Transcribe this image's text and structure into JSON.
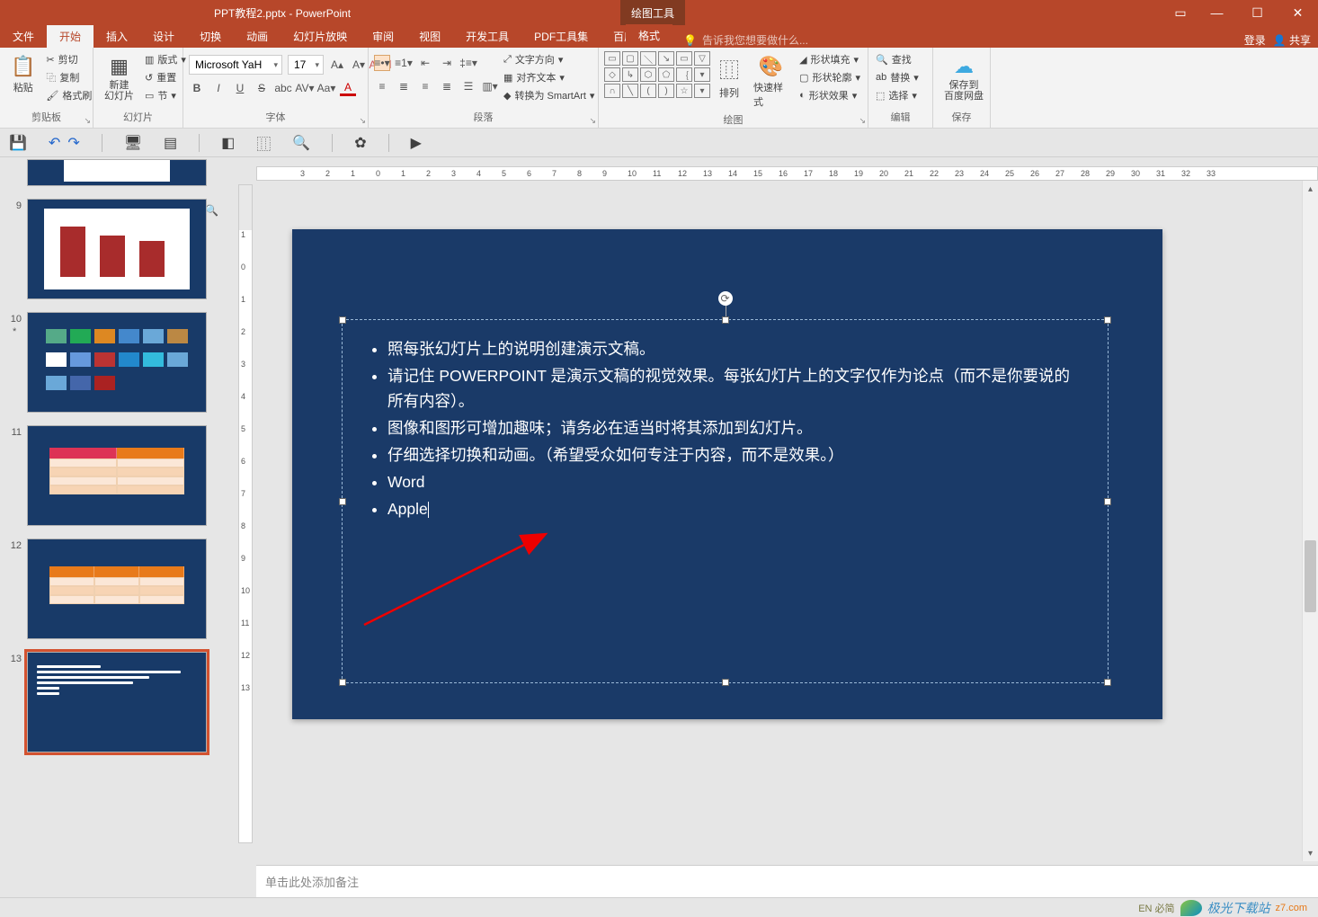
{
  "title": {
    "filename": "PPT教程2.pptx - PowerPoint",
    "drawing_tools": "绘图工具",
    "format_tab": "格式"
  },
  "window": {
    "login": "登录",
    "share": "共享"
  },
  "tell_me": "告诉我您想要做什么...",
  "menu": {
    "file": "文件",
    "home": "开始",
    "insert": "插入",
    "design": "设计",
    "transitions": "切换",
    "animations": "动画",
    "slideshow": "幻灯片放映",
    "review": "审阅",
    "view": "视图",
    "dev": "开发工具",
    "pdf": "PDF工具集",
    "baidu": "百度网盘"
  },
  "ribbon": {
    "clipboard": {
      "label": "剪贴板",
      "paste": "粘贴",
      "cut": "剪切",
      "copy": "复制",
      "painter": "格式刷"
    },
    "slides": {
      "label": "幻灯片",
      "new_slide": "新建\n幻灯片",
      "layout": "版式",
      "reset": "重置",
      "section": "节"
    },
    "font": {
      "label": "字体",
      "font_name": "Microsoft YaH",
      "font_size": "17",
      "bold": "B",
      "italic": "I",
      "underline": "U",
      "strike": "S",
      "shadow": "abc",
      "spacing": "AV",
      "case": "Aa"
    },
    "paragraph": {
      "label": "段落",
      "text_direction": "文字方向",
      "align_text": "对齐文本",
      "convert_smartart": "转换为 SmartArt"
    },
    "drawing": {
      "label": "绘图",
      "arrange": "排列",
      "quick_styles": "快速样式",
      "shape_fill": "形状填充",
      "shape_outline": "形状轮廓",
      "shape_effects": "形状效果"
    },
    "editing": {
      "label": "编辑",
      "find": "查找",
      "replace": "替换",
      "select": "选择"
    },
    "save": {
      "label": "保存",
      "save_to": "保存到\n百度网盘"
    }
  },
  "thumbs": [
    {
      "num": "9"
    },
    {
      "num": "10",
      "star": "*"
    },
    {
      "num": "11"
    },
    {
      "num": "12"
    },
    {
      "num": "13"
    }
  ],
  "slide": {
    "bullets": [
      "照每张幻灯片上的说明创建演示文稿。",
      "请记住 POWERPOINT 是演示文稿的视觉效果。每张幻灯片上的文字仅作为论点（而不是你要说的所有内容）。",
      "图像和图形可增加趣味；请务必在适当时将其添加到幻灯片。",
      "仔细选择切换和动画。（希望受众如何专注于内容，而不是效果。）",
      "Word",
      "Apple"
    ]
  },
  "notes_placeholder": "单击此处添加备注",
  "ruler_h": [
    "3",
    "2",
    "1",
    "0",
    "1",
    "2",
    "3",
    "4",
    "5",
    "6",
    "7",
    "8",
    "9",
    "10",
    "11",
    "12",
    "13",
    "14",
    "15",
    "16",
    "17",
    "18",
    "19",
    "20",
    "21",
    "22",
    "23",
    "24",
    "25",
    "26",
    "27",
    "28",
    "29",
    "30",
    "31",
    "32",
    "33"
  ],
  "ruler_v": [
    "1",
    "0",
    "1",
    "2",
    "3",
    "4",
    "5",
    "6",
    "7",
    "8",
    "9",
    "10",
    "11",
    "12",
    "13"
  ],
  "watermark": {
    "brand": "极光下载站",
    "ime": "EN 必简",
    "domain": "z7.com"
  }
}
